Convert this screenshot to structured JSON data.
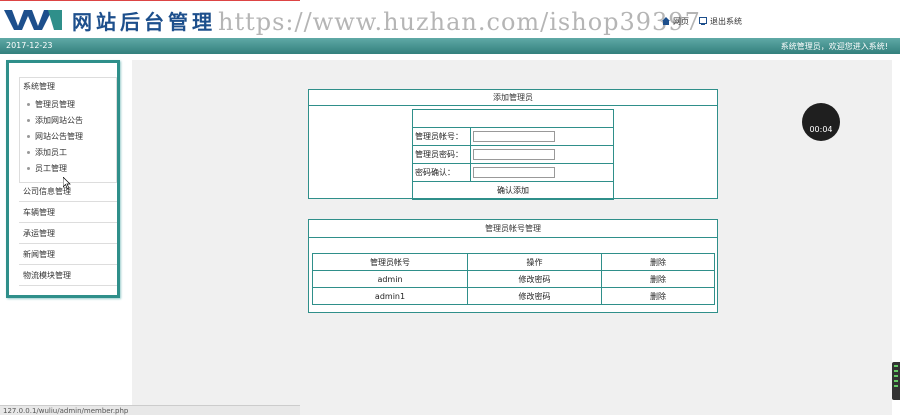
{
  "header": {
    "site_title": "网站后台管理",
    "watermark": "https://www.huzhan.com/ishop39397",
    "links": [
      {
        "label": "网页",
        "icon": "home-icon"
      },
      {
        "label": "退出系统",
        "icon": "logout-icon"
      }
    ],
    "date": "2017-12-23",
    "welcome": "系统管理员，欢迎您进入系统!"
  },
  "sidebar": {
    "open_group": {
      "title": "系统管理",
      "items": [
        {
          "label": "管理员管理"
        },
        {
          "label": "添加网站公告"
        },
        {
          "label": "网站公告管理"
        },
        {
          "label": "添加员工"
        },
        {
          "label": "员工管理"
        }
      ]
    },
    "groups": [
      {
        "label": "公司信息管理"
      },
      {
        "label": "车辆管理"
      },
      {
        "label": "承运管理"
      },
      {
        "label": "新闻管理"
      },
      {
        "label": "物流模块管理"
      }
    ]
  },
  "add_admin": {
    "title": "添加管理员",
    "account_label": "管理员帐号：",
    "account_value": "",
    "password_label": "管理员密码：",
    "password_value": "",
    "confirm_label": "密码确认：",
    "confirm_value": "",
    "submit_label": "确认添加"
  },
  "admin_list": {
    "title": "管理员帐号管理",
    "columns": [
      "管理员帐号",
      "操作",
      "删除"
    ],
    "rows": [
      {
        "account": "admin",
        "action": "修改密码",
        "delete": "删除"
      },
      {
        "account": "admin1",
        "action": "修改密码",
        "delete": "删除"
      }
    ]
  },
  "video_timer": "00:04",
  "status_url": "127.0.0.1/wuliu/admin/member.php",
  "colors": {
    "accent": "#2f8f8a",
    "title_blue": "#1d4f8c",
    "bar_teal": "#3f8d8a"
  }
}
